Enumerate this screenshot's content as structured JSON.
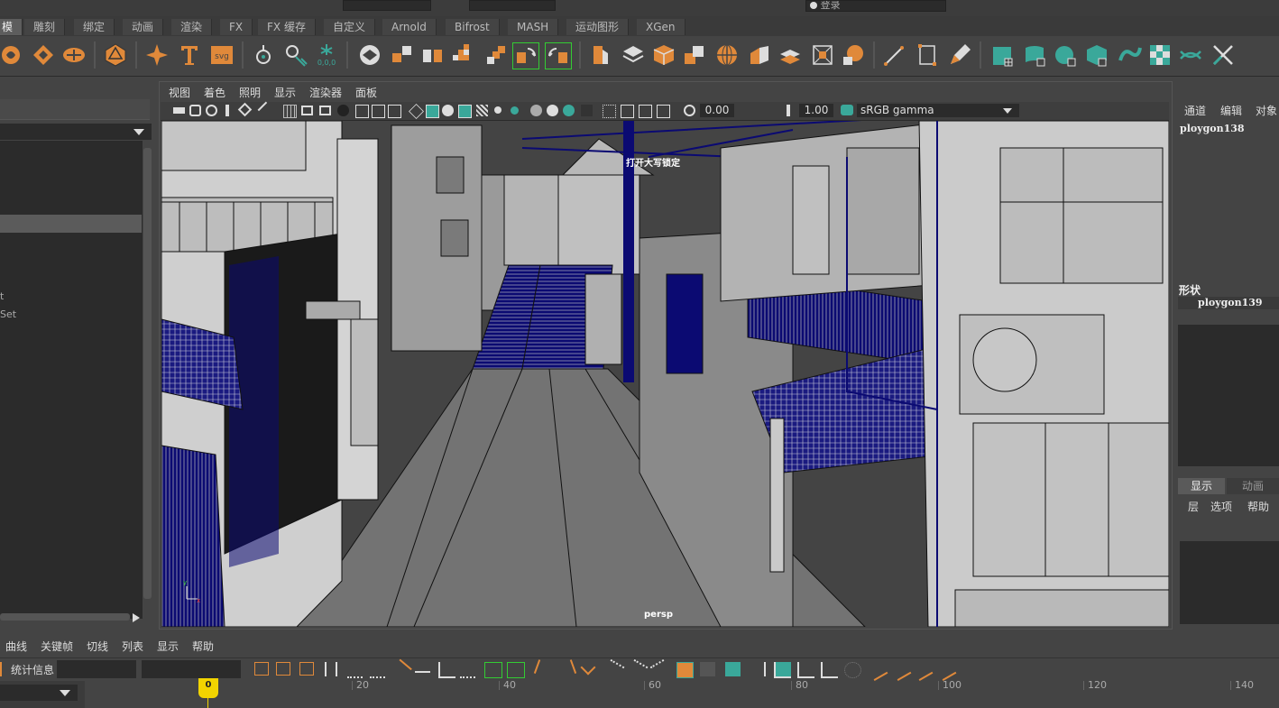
{
  "shelf_tabs": [
    "模",
    "雕刻",
    "绑定",
    "动画",
    "渲染",
    "FX",
    "FX 缓存",
    "自定义",
    "Arnold",
    "Bifrost",
    "MASH",
    "运动图形",
    "XGen"
  ],
  "top_right_button": "登录",
  "viewport_menu": [
    "视图",
    "着色",
    "照明",
    "显示",
    "渲染器",
    "面板"
  ],
  "viewport_toolbar": {
    "field_a": "0.00",
    "field_b": "1.00",
    "color_space": "sRGB gamma"
  },
  "viewport": {
    "hud_message": "打开大写锁定",
    "camera_label": "persp"
  },
  "left_panel": {
    "partial_items": [
      "t",
      "Set"
    ]
  },
  "channel_box": {
    "menu": [
      "通道",
      "编辑",
      "对象"
    ],
    "object_name": "ploygon138",
    "shape_header": "形状",
    "shape_name": "ploygon139"
  },
  "layer_editor": {
    "tabs": [
      "显示",
      "动画"
    ],
    "menu": [
      "层",
      "选项",
      "帮助"
    ]
  },
  "graph_menu": [
    "曲线",
    "关键帧",
    "切线",
    "列表",
    "显示",
    "帮助"
  ],
  "stats_label": "统计信息",
  "timeline": {
    "current_frame": "0",
    "ticks": [
      "20",
      "40",
      "60",
      "80",
      "100",
      "120",
      "140"
    ]
  },
  "colors": {
    "ui_bg": "#444444",
    "accent_orange": "#e0893a",
    "accent_teal": "#3aa89a",
    "wireframe_blue": "#0b0a72",
    "current_frame_yellow": "#f2d400"
  }
}
